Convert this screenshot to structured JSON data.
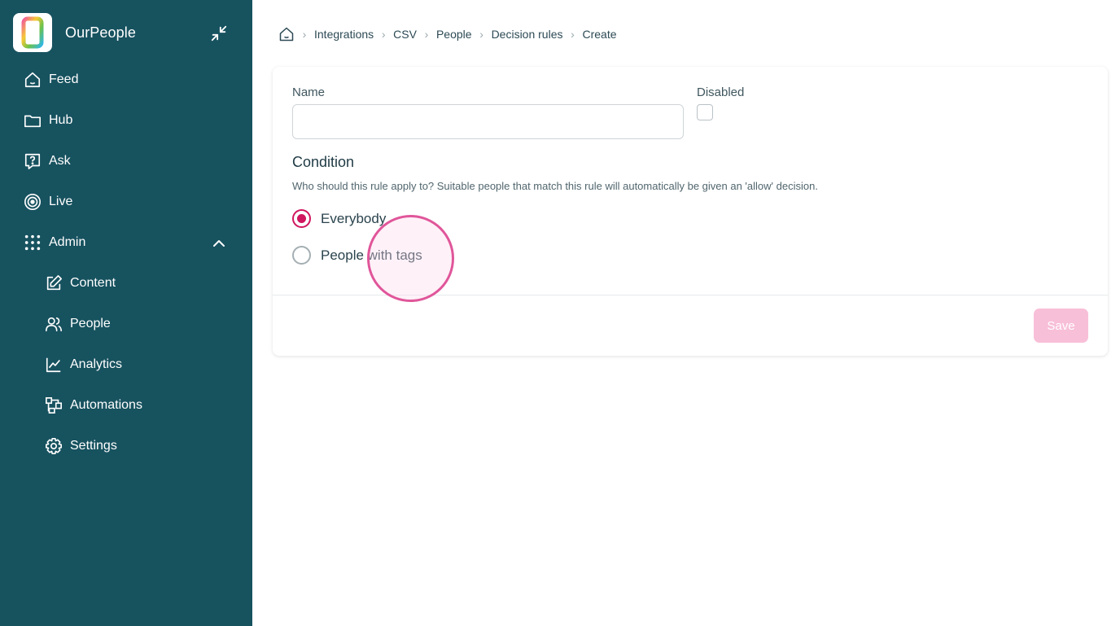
{
  "app": {
    "name": "OurPeople",
    "logo_icon": "ourpeople-logo-icon",
    "collapse_icon": "minimize-arrows-icon"
  },
  "colors": {
    "sidebar": "#17525f",
    "accent": "#d0165f",
    "save_disabled": "#f8bfd8",
    "click_indicator": "#e0569a"
  },
  "sidebar": {
    "items": [
      {
        "label": "Feed",
        "icon": "home-icon"
      },
      {
        "label": "Hub",
        "icon": "folder-icon"
      },
      {
        "label": "Ask",
        "icon": "question-icon"
      },
      {
        "label": "Live",
        "icon": "target-icon"
      },
      {
        "label": "Admin",
        "icon": "grid-dots-icon",
        "expanded": true
      }
    ],
    "admin_items": [
      {
        "label": "Content",
        "icon": "edit-icon"
      },
      {
        "label": "People",
        "icon": "users-icon"
      },
      {
        "label": "Analytics",
        "icon": "chart-line-icon"
      },
      {
        "label": "Automations",
        "icon": "workflow-icon"
      },
      {
        "label": "Settings",
        "icon": "gear-icon"
      }
    ]
  },
  "breadcrumb": {
    "home_icon": "home-icon",
    "items": [
      "Integrations",
      "CSV",
      "People",
      "Decision rules",
      "Create"
    ]
  },
  "form": {
    "name_label": "Name",
    "name_value": "",
    "disabled_label": "Disabled",
    "disabled_checked": false,
    "condition_title": "Condition",
    "condition_help": "Who should this rule apply to? Suitable people that match this rule will automatically be given an 'allow' decision.",
    "options": [
      {
        "label": "Everybody",
        "selected": true
      },
      {
        "label": "People with tags",
        "selected": false
      }
    ],
    "save_label": "Save"
  }
}
